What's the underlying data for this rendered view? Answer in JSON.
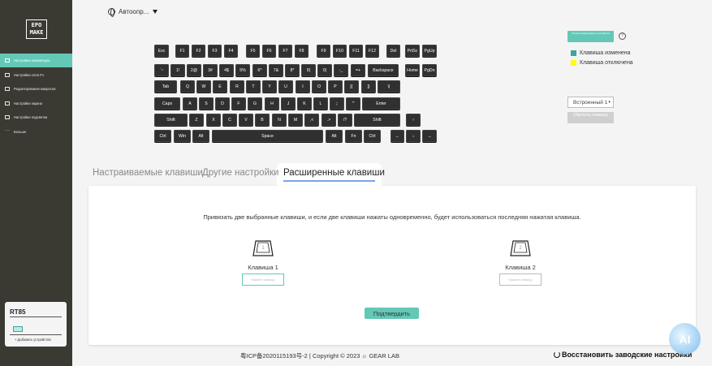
{
  "sidebar": {
    "logo": "EPOMAKER",
    "items": [
      {
        "label": "Настройки клавиатуры",
        "icon": "keyboard-icon",
        "active": true
      },
      {
        "label": "Настройки слоя Fn",
        "icon": "layer-icon",
        "active": false
      },
      {
        "label": "Редактирование макросов",
        "icon": "macro-icon",
        "active": false
      },
      {
        "label": "Настройки экрана",
        "icon": "screen-icon",
        "active": false
      },
      {
        "label": "Настройки подсветки",
        "icon": "light-icon",
        "active": false
      },
      {
        "label": "Больше",
        "icon": "more-icon",
        "active": false
      }
    ],
    "device": {
      "name": "RT85",
      "add_label": "+ Добавить устройство"
    }
  },
  "topbar": {
    "language": "Автоопр..."
  },
  "keyboard": {
    "rows": [
      [
        "Esc",
        "F1",
        "F2",
        "F3",
        "F4",
        "F5",
        "F6",
        "F7",
        "F8",
        "F9",
        "F10",
        "F11",
        "F12",
        "Del",
        "PrtSc",
        "PgUp"
      ],
      [
        "`~",
        "1!",
        "2@",
        "3#",
        "4$",
        "5%",
        "6^",
        "7&",
        "8*",
        "9(",
        "0)",
        "-_",
        "=+",
        "Backspace",
        "Home",
        "PgDn"
      ],
      [
        "Tab",
        "Q",
        "W",
        "E",
        "R",
        "T",
        "Y",
        "U",
        "I",
        "O",
        "P",
        "[{",
        "]}",
        "\\|"
      ],
      [
        "Caps",
        "A",
        "S",
        "D",
        "F",
        "G",
        "H",
        "J",
        "K",
        "L",
        ";:",
        "'\"",
        "Enter"
      ],
      [
        "Shift",
        "Z",
        "X",
        "C",
        "V",
        "B",
        "N",
        "M",
        ",<",
        ".>",
        "/?",
        "Shift",
        "↑"
      ],
      [
        "Ctrl",
        "Win",
        "Alt",
        "Space",
        "Alt",
        "Fn",
        "Ctrl",
        "←",
        "↓",
        "→"
      ]
    ]
  },
  "controls": {
    "config_button": "Точная конфигурация устройства",
    "help": "?",
    "legend": [
      {
        "label": "Клавиша изменена",
        "color": "#3aa896"
      },
      {
        "label": "Клавиша отключена",
        "color": "#ffff00"
      }
    ],
    "layer": "Встроенный 1",
    "reset_button": "Сбросить клавишу"
  },
  "tabs": [
    {
      "label": "Настраиваемые клавиши",
      "active": false
    },
    {
      "label": "Другие настройки",
      "active": false
    },
    {
      "label": "Расширенные клавиши",
      "active": true
    }
  ],
  "panel": {
    "description": "Привязать две выбранные клавиши, и если две клавиши нажаты одновременно, будет использоваться последняя нажатая клавиша.",
    "key1": {
      "number": "1",
      "label": "Клавиша 1",
      "placeholder": "Нажмите клавишу"
    },
    "key2": {
      "number": "2",
      "label": "Клавиша 2",
      "placeholder": "Нажмите клавишу"
    },
    "confirm": "Подтвердить"
  },
  "footer": {
    "copyright": "粤ICP备2020115193号-2 | Copyright © 2023 ☼ GEAR LAB",
    "restore": "Восстановить заводские настройки",
    "ai_badge": "AI"
  }
}
